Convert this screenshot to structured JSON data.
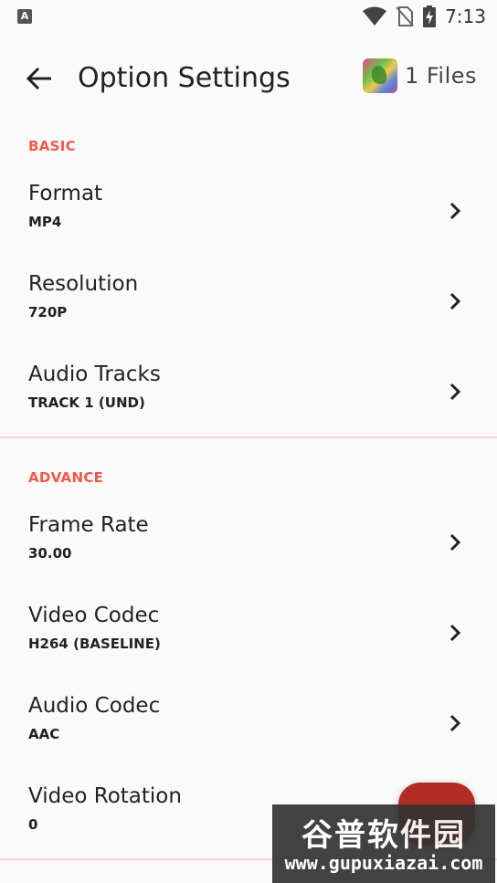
{
  "status_bar": {
    "app_icon_letter": "A",
    "time": "7:13",
    "icons": [
      "wifi-icon",
      "no-sim-icon",
      "battery-charging-icon"
    ]
  },
  "header": {
    "title": "Option Settings",
    "files_label": "1 Files",
    "back_icon": "arrow-back-icon"
  },
  "sections": {
    "basic": {
      "label": "BASIC",
      "items": [
        {
          "title": "Format",
          "value": "MP4"
        },
        {
          "title": "Resolution",
          "value": "720P"
        },
        {
          "title": "Audio Tracks",
          "value": "TRACK 1 (UND)"
        }
      ]
    },
    "advance": {
      "label": "ADVANCE",
      "items": [
        {
          "title": "Frame Rate",
          "value": "30.00"
        },
        {
          "title": "Video Codec",
          "value": "H264 (BASELINE)"
        },
        {
          "title": "Audio Codec",
          "value": "AAC"
        },
        {
          "title": "Video Rotation",
          "value": "0"
        }
      ]
    }
  },
  "watermark": {
    "title": "谷普软件园",
    "url": "www.gupuxiazai.com"
  },
  "colors": {
    "accent": "#ef5a4a",
    "fab": "#b32c24",
    "divider": "#f5d7d5",
    "background": "#fafafa"
  }
}
